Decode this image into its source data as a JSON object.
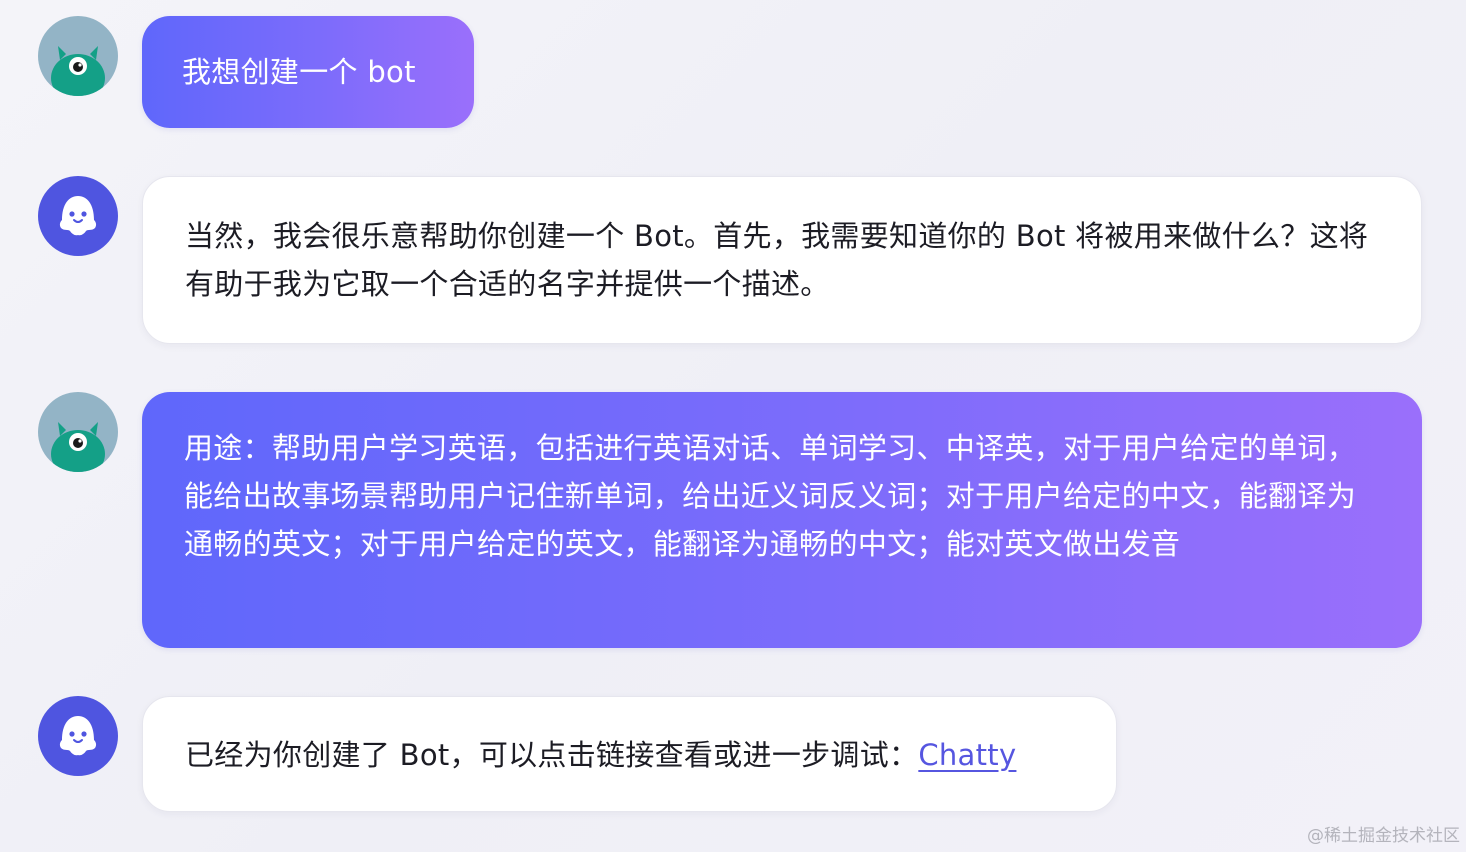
{
  "messages": [
    {
      "role": "user",
      "text": "我想创建一个 bot"
    },
    {
      "role": "assistant",
      "text": "当然，我会很乐意帮助你创建一个 Bot。首先，我需要知道你的 Bot 将被用来做什么？这将有助于我为它取一个合适的名字并提供一个描述。"
    },
    {
      "role": "user",
      "text": "用途：帮助用户学习英语，包括进行英语对话、单词学习、中译英，对于用户给定的单词，能给出故事场景帮助用户记住新单词，给出近义词反义词；对于用户给定的中文，能翻译为通畅的英文；对于用户给定的英文，能翻译为通畅的中文；能对英文做出发音"
    },
    {
      "role": "assistant",
      "text": "已经为你创建了 Bot，可以点击链接查看或进一步调试：",
      "link_text": "Chatty"
    }
  ],
  "user_avatar": {
    "icon": "green-cyclops-monster-icon",
    "bg": "#93b4c6",
    "color": "#14a087"
  },
  "bot_avatar": {
    "icon": "ghost-icon",
    "bg": "#4f55e0",
    "color": "#ffffff"
  },
  "colors": {
    "user_bubble_start": "#5f67fb",
    "user_bubble_end": "#9a6ffb",
    "link": "#5656e0"
  },
  "watermark": "@稀土掘金技术社区"
}
